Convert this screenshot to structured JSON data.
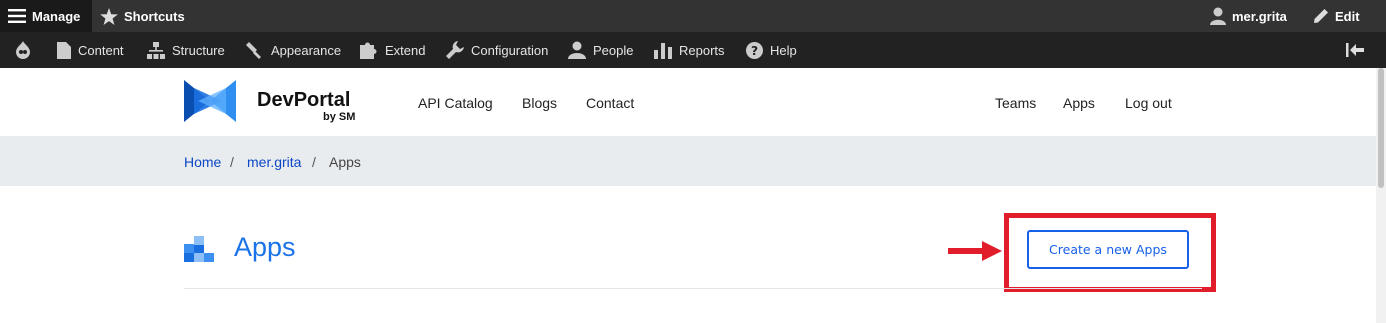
{
  "admin_toolbar": {
    "manage_label": "Manage",
    "shortcuts_label": "Shortcuts",
    "user_label": "mer.grita",
    "edit_label": "Edit",
    "tray_items": [
      "Content",
      "Structure",
      "Appearance",
      "Extend",
      "Configuration",
      "People",
      "Reports",
      "Help"
    ]
  },
  "site_header": {
    "brand": "DevPortal",
    "brand_sub": "by SM",
    "nav_main": [
      "API Catalog",
      "Blogs",
      "Contact"
    ],
    "nav_user": [
      "Teams",
      "Apps",
      "Log out"
    ]
  },
  "breadcrumb": {
    "items": [
      "Home",
      "mer.grita",
      "Apps"
    ],
    "separator": "/"
  },
  "page": {
    "title": "Apps",
    "create_button_label": "Create a new Apps"
  },
  "colors": {
    "accent": "#1a73e8",
    "highlight": "#e11d2b",
    "toolbar_dark": "#222222"
  }
}
